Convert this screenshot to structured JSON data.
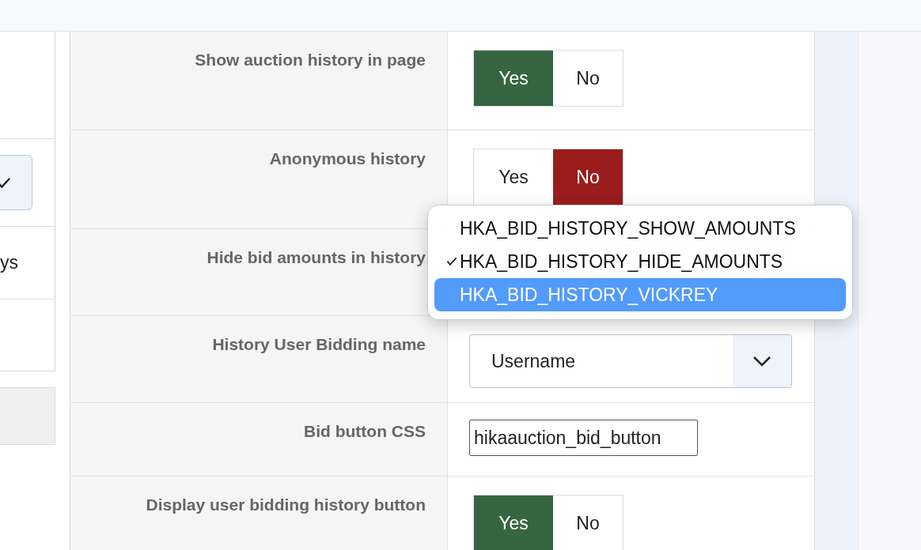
{
  "left_panel": {
    "rows": [
      {
        "kind": "blank"
      },
      {
        "kind": "select"
      },
      {
        "kind": "text",
        "text": "ys"
      },
      {
        "kind": "blank"
      }
    ]
  },
  "settings": [
    {
      "label": "Show auction history in page",
      "kind": "toggle",
      "options": [
        {
          "label": "Yes",
          "selected": true
        },
        {
          "label": "No",
          "selected": false
        }
      ]
    },
    {
      "label": "Anonymous history",
      "kind": "toggle",
      "options": [
        {
          "label": "Yes",
          "selected": false
        },
        {
          "label": "No",
          "selected": true
        }
      ]
    },
    {
      "label": "Hide bid amounts in history",
      "kind": "select",
      "expanded": true
    },
    {
      "label": "History User Bidding name",
      "kind": "select",
      "value": "Username"
    },
    {
      "label": "Bid button CSS",
      "kind": "input",
      "value": "hikaauction_bid_button"
    },
    {
      "label": "Display user bidding history button",
      "kind": "toggle",
      "options": [
        {
          "label": "Yes",
          "selected": true
        },
        {
          "label": "No",
          "selected": false
        }
      ]
    }
  ],
  "dropdown": {
    "options": [
      {
        "label": "HKA_BID_HISTORY_SHOW_AMOUNTS",
        "checked": false,
        "selected": false
      },
      {
        "label": "HKA_BID_HISTORY_HIDE_AMOUNTS",
        "checked": true,
        "selected": false
      },
      {
        "label": "HKA_BID_HISTORY_VICKREY",
        "checked": false,
        "selected": true
      }
    ]
  }
}
